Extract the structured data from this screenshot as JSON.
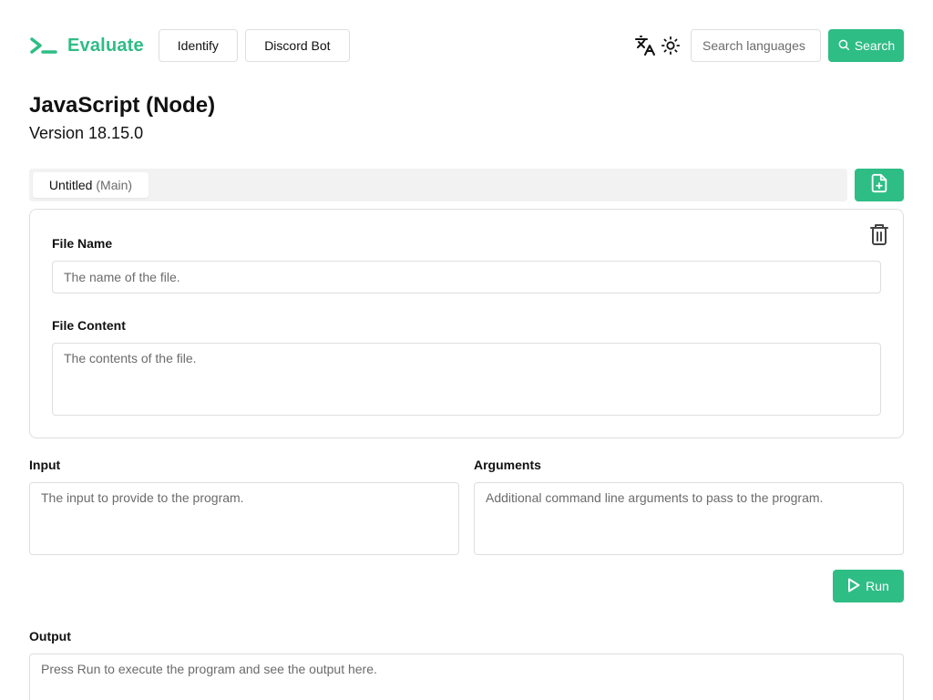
{
  "header": {
    "brand": "Evaluate",
    "nav": [
      {
        "label": "Identify"
      },
      {
        "label": "Discord Bot"
      }
    ],
    "search": {
      "placeholder": "Search languages",
      "button_label": "Search"
    }
  },
  "language": {
    "title": "JavaScript (Node)",
    "version": "Version 18.15.0"
  },
  "tabs": [
    {
      "label": "Untitled",
      "sublabel": "(Main)"
    }
  ],
  "file": {
    "name_label": "File Name",
    "name_placeholder": "The name of the file.",
    "content_label": "File Content",
    "content_placeholder": "The contents of the file."
  },
  "input": {
    "label": "Input",
    "placeholder": "The input to provide to the program."
  },
  "arguments": {
    "label": "Arguments",
    "placeholder": "Additional command line arguments to pass to the program."
  },
  "run": {
    "label": "Run"
  },
  "output": {
    "label": "Output",
    "placeholder": "Press Run to execute the program and see the output here."
  },
  "colors": {
    "accent": "#2ebd85",
    "border": "#dedede",
    "muted": "#6b6b6b"
  },
  "icons": [
    "terminal-logo-icon",
    "translate-icon",
    "sun-icon",
    "search-icon",
    "file-plus-icon",
    "trash-icon",
    "play-icon"
  ]
}
